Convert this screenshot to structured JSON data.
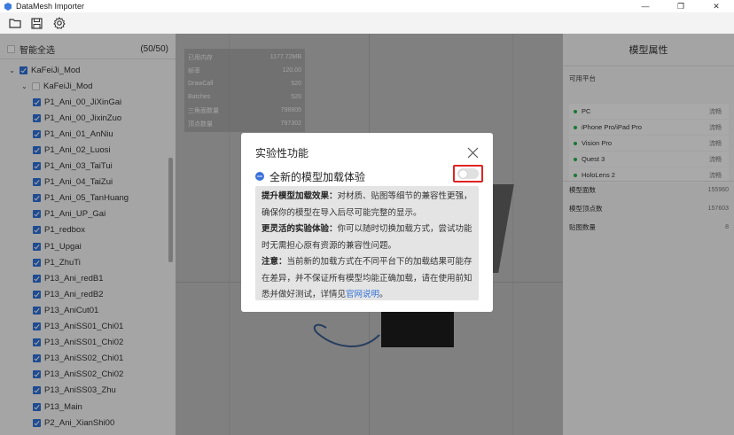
{
  "window": {
    "title": "DataMesh Importer",
    "controls": [
      "—",
      "❐",
      "✕"
    ]
  },
  "toolbar": {
    "icons": [
      "folder-icon",
      "save-icon",
      "gear-icon"
    ]
  },
  "left_panel": {
    "select_all_label": "智能全选",
    "count": "(50/50)",
    "tree": [
      {
        "label": "KaFeiJi_Mod",
        "level": 0,
        "caret": true,
        "checked": true
      },
      {
        "label": "KaFeiJi_Mod",
        "level": 1,
        "caret": true,
        "checked": false
      },
      {
        "label": "P1_Ani_00_JiXinGai",
        "level": 2,
        "caret": false,
        "checked": true
      },
      {
        "label": "P1_Ani_00_JixinZuo",
        "level": 2,
        "caret": false,
        "checked": true
      },
      {
        "label": "P1_Ani_01_AnNiu",
        "level": 2,
        "caret": false,
        "checked": true
      },
      {
        "label": "P1_Ani_02_Luosi",
        "level": 2,
        "caret": false,
        "checked": true
      },
      {
        "label": "P1_Ani_03_TaiTui",
        "level": 2,
        "caret": false,
        "checked": true
      },
      {
        "label": "P1_Ani_04_TaiZui",
        "level": 2,
        "caret": false,
        "checked": true
      },
      {
        "label": "P1_Ani_05_TanHuang",
        "level": 2,
        "caret": false,
        "checked": true
      },
      {
        "label": "P1_Ani_UP_Gai",
        "level": 2,
        "caret": false,
        "checked": true
      },
      {
        "label": "P1_redbox",
        "level": 2,
        "caret": false,
        "checked": true
      },
      {
        "label": "P1_Upgai",
        "level": 2,
        "caret": false,
        "checked": true
      },
      {
        "label": "P1_ZhuTi",
        "level": 2,
        "caret": false,
        "checked": true
      },
      {
        "label": "P13_Ani_redB1",
        "level": 2,
        "caret": false,
        "checked": true
      },
      {
        "label": "P13_Ani_redB2",
        "level": 2,
        "caret": false,
        "checked": true
      },
      {
        "label": "P13_AniCut01",
        "level": 2,
        "caret": false,
        "checked": true
      },
      {
        "label": "P13_AniSS01_Chi01",
        "level": 2,
        "caret": false,
        "checked": true
      },
      {
        "label": "P13_AniSS01_Chi02",
        "level": 2,
        "caret": false,
        "checked": true
      },
      {
        "label": "P13_AniSS02_Chi01",
        "level": 2,
        "caret": false,
        "checked": true
      },
      {
        "label": "P13_AniSS02_Chi02",
        "level": 2,
        "caret": false,
        "checked": true
      },
      {
        "label": "P13_AniSS03_Zhu",
        "level": 2,
        "caret": false,
        "checked": true
      },
      {
        "label": "P13_Main",
        "level": 2,
        "caret": false,
        "checked": true
      },
      {
        "label": "P2_Ani_XianShi00",
        "level": 2,
        "caret": false,
        "checked": true
      }
    ]
  },
  "viewport": {
    "stats": [
      {
        "label": "已用内存",
        "value": "1177.72MB"
      },
      {
        "label": "帧率",
        "value": "120.00"
      },
      {
        "label": "DrawCall",
        "value": "520"
      },
      {
        "label": "Batches",
        "value": "520"
      },
      {
        "label": "三角面数量",
        "value": "798805"
      },
      {
        "label": "顶点数量",
        "value": "797302"
      }
    ]
  },
  "right_panel": {
    "title": "模型属性",
    "platforms_label": "可用平台",
    "platforms": [
      {
        "name": "PC",
        "badge": "流畅"
      },
      {
        "name": "iPhone Pro/iPad Pro",
        "badge": "流畅"
      },
      {
        "name": "Vision Pro",
        "badge": "流畅"
      },
      {
        "name": "Quest 3",
        "badge": "流畅"
      },
      {
        "name": "HoloLens 2",
        "badge": "流畅"
      }
    ],
    "metrics": [
      {
        "label": "模型面数",
        "value": "155960"
      },
      {
        "label": "模型顶点数",
        "value": "157603"
      },
      {
        "label": "贴图数量",
        "value": "8"
      }
    ]
  },
  "modal": {
    "title": "实验性功能",
    "feature_label": "全新的模型加载体验",
    "toggle_on": false,
    "p1_bold": "提升模型加载效果：",
    "p1_text": "对材质、贴图等细节的兼容性更强，确保你的模型在导入后尽可能完整的显示。",
    "p2_bold": "更灵活的实验体验：",
    "p2_text": "你可以随时切换加载方式，尝试功能时无需担心原有资源的兼容性问题。",
    "p3_bold": "注意：",
    "p3_text": "当前新的加载方式在不同平台下的加载结果可能存在差异，并不保证所有模型均能正确加载，请在使用前知悉并做好测试，详情见",
    "p3_link": "官网说明",
    "p3_end": "。"
  }
}
